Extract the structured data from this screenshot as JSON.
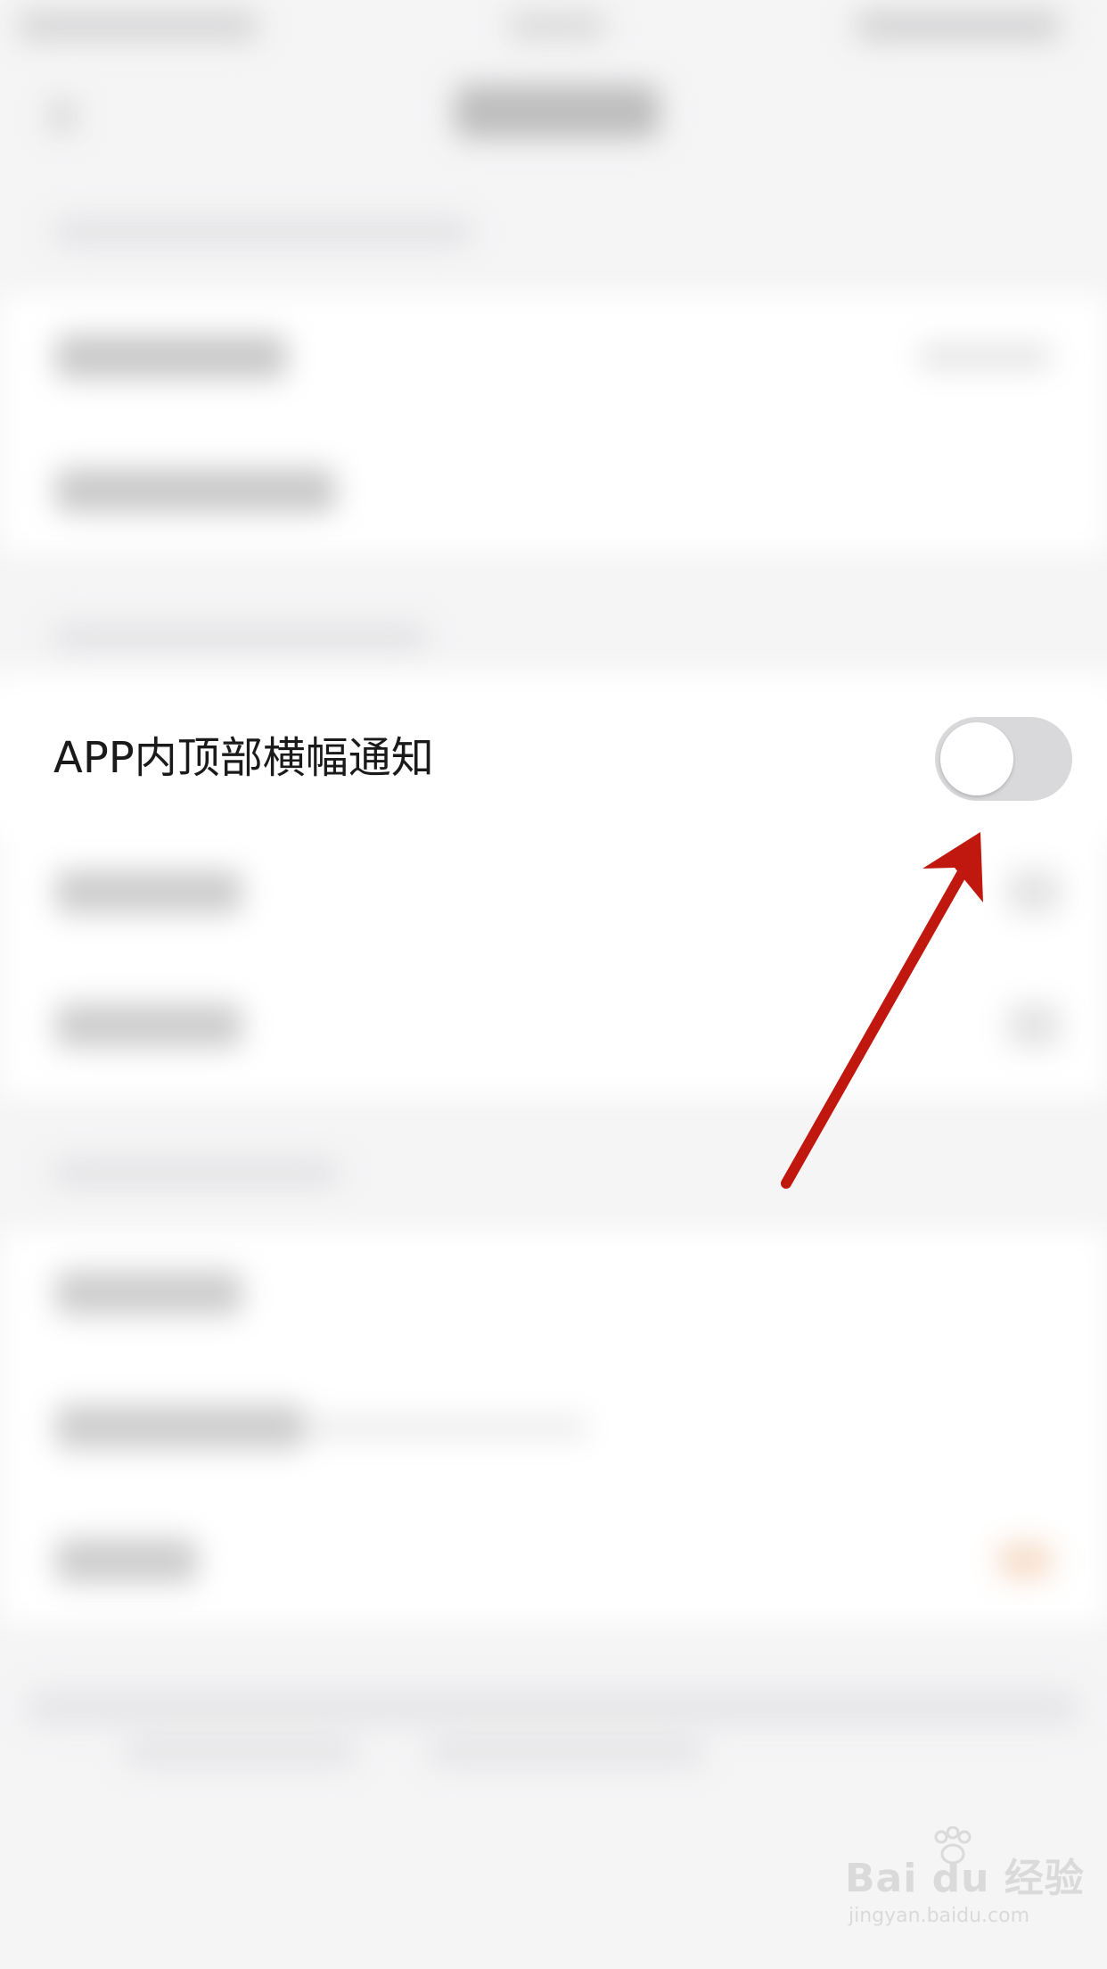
{
  "settings": {
    "banner_notification_label": "APP内顶部横幅通知",
    "banner_notification_enabled": false
  },
  "colors": {
    "annotation_arrow": "#c0180f",
    "toggle_off_track": "#d9d9db"
  },
  "watermark": {
    "brand": "Bai du 经验",
    "url": "jingyan.baidu.com"
  },
  "icons": {
    "annotation": "arrow-up-right-icon",
    "watermark": "baidu-paw-icon"
  }
}
